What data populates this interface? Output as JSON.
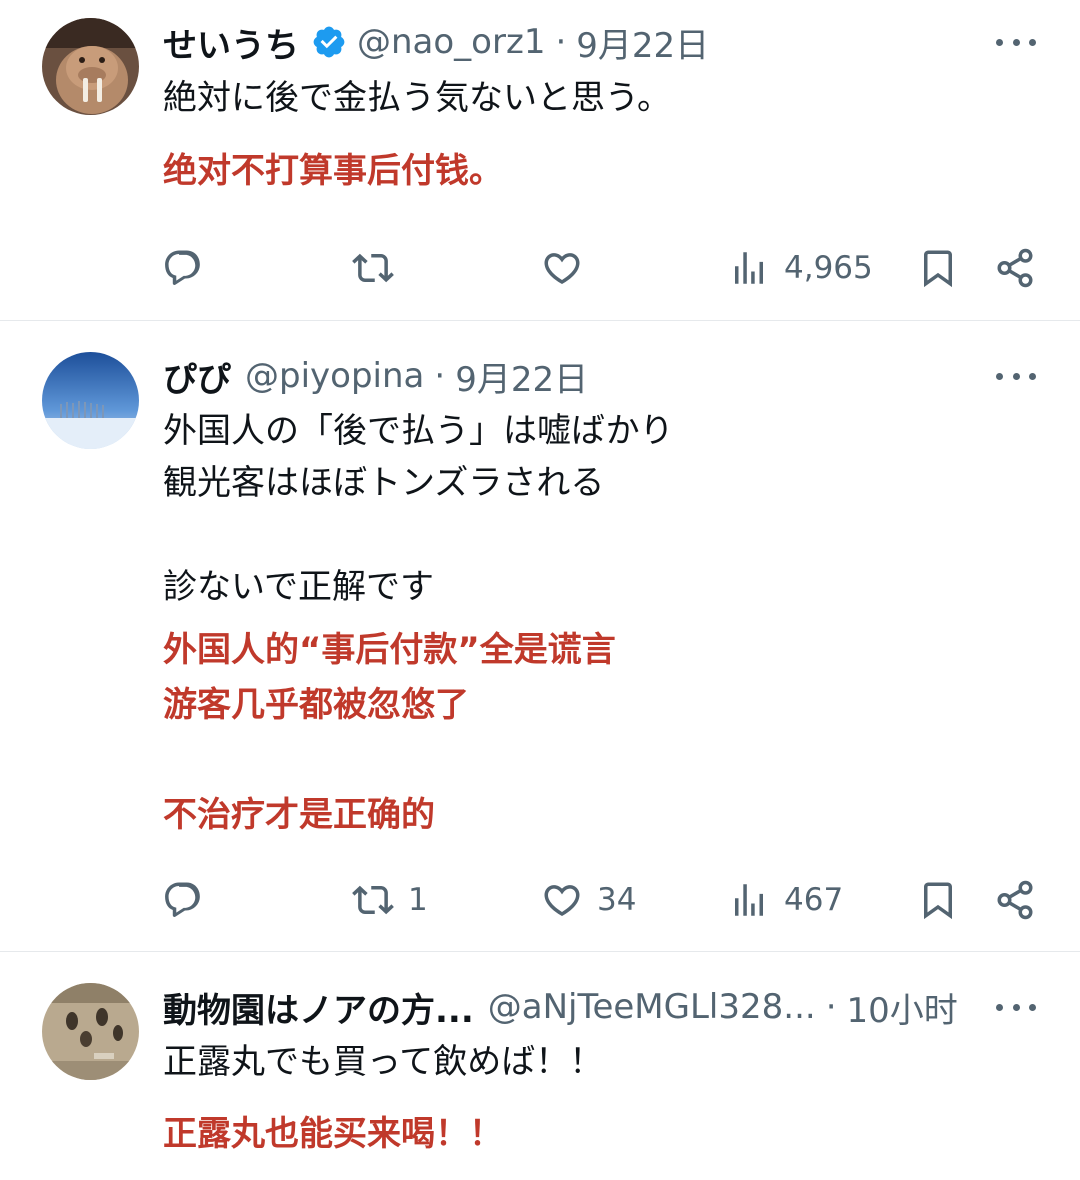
{
  "tweets": [
    {
      "name": "せいうち",
      "verified": true,
      "handle": "@nao_orz1",
      "separator": "·",
      "time": "9月22日",
      "text": "絶対に後で金払う気ないと思う。",
      "translation": "绝对不打算事后付钱。",
      "counts": {
        "reply": "",
        "retweet": "",
        "like": "",
        "views": "4,965"
      }
    },
    {
      "name": "ぴぴ",
      "verified": false,
      "handle": "@piyopina",
      "separator": "·",
      "time": "9月22日",
      "text": "外国人の「後で払う」は嘘ばかり\n観光客はほぼトンズラされる\n\n診ないで正解です",
      "translation": "外国人的“事后付款”全是谎言\n游客几乎都被忽悠了\n\n不治疗才是正确的",
      "counts": {
        "reply": "",
        "retweet": "1",
        "like": "34",
        "views": "467"
      }
    },
    {
      "name": "動物園はノアの方...",
      "verified": false,
      "handle": "@aNjTeeMGLl328...",
      "separator": "·",
      "time": "10小时",
      "text": "正露丸でも買って飲めば！！",
      "translation": "正露丸也能买来喝！！"
    }
  ],
  "colors": {
    "accent_translation": "#c0392b",
    "verified_badge": "#1d9bf0",
    "secondary_text": "#536471"
  },
  "icons": [
    "reply-icon",
    "retweet-icon",
    "like-icon",
    "views-icon",
    "bookmark-icon",
    "share-icon",
    "more-icon",
    "verified-badge-icon"
  ]
}
